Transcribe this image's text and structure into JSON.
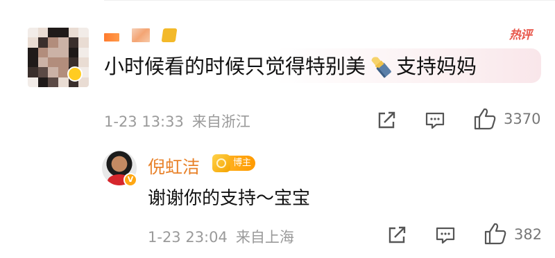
{
  "comment": {
    "hot_label": "热评",
    "text_part1": "小时候看的时候只觉得特别美",
    "emoji_icon": "lipstick-emoji-icon",
    "text_part2": "支持妈妈",
    "date": "1-23 13:33",
    "from": "来自浙江",
    "like_count": "3370"
  },
  "reply": {
    "author": "倪虹洁",
    "badge": "博主",
    "text": "谢谢你的支持～宝宝",
    "date": "1-23 23:04",
    "from": "来自上海",
    "like_count": "382"
  },
  "icons": {
    "share": "share-icon",
    "comment": "comment-icon",
    "like": "like-icon"
  },
  "colors": {
    "author_name": "#e8822a",
    "hot_badge": "#e8564a",
    "meta_text": "#9a9a9a",
    "badge_bg": "#ff9a00"
  }
}
